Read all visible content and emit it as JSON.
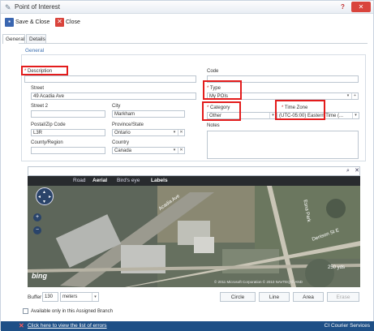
{
  "window": {
    "title": "Point of Interest",
    "help_glyph": "?",
    "close_glyph": "✕"
  },
  "toolbar": {
    "save_close_label": "Save & Close",
    "close_label": "Close"
  },
  "tabs": [
    {
      "label": "General",
      "active": true
    },
    {
      "label": "Details",
      "active": false
    }
  ],
  "section": {
    "title": "General"
  },
  "form": {
    "description": {
      "label": "Description",
      "value": ""
    },
    "code": {
      "label": "Code",
      "value": ""
    },
    "street": {
      "label": "Street",
      "value": "49 Acadia Ave"
    },
    "type": {
      "label": "Type",
      "value": "My POIs"
    },
    "street2": {
      "label": "Street 2",
      "value": ""
    },
    "city": {
      "label": "City",
      "value": "Markham"
    },
    "category": {
      "label": "Category",
      "value": "Other"
    },
    "timezone": {
      "label": "Time Zone",
      "value": "(UTC-05:00) Eastern Time (..."
    },
    "postal": {
      "label": "Postal/Zip Code",
      "value": "L3R"
    },
    "province": {
      "label": "Province/State",
      "value": "Ontario"
    },
    "notes": {
      "label": "Notes",
      "value": ""
    },
    "county": {
      "label": "County/Region",
      "value": ""
    },
    "country": {
      "label": "Country",
      "value": "Canada"
    }
  },
  "search": {
    "value": ""
  },
  "map": {
    "tabs": [
      "Road",
      "Aerial",
      "Bird's eye",
      "Labels"
    ],
    "selected_tab": "Aerial",
    "street_labels": [
      "Acadia Ave",
      "Esna Park",
      "Denison St E"
    ],
    "scale_label": "250 yds",
    "logo": "bing",
    "copyright": "© 2011 Microsoft Corporation © 2010 NAVTEQ © AND"
  },
  "buffer": {
    "label": "Buffer",
    "value": "130",
    "unit": "meters"
  },
  "draw_buttons": [
    "Circle",
    "Line",
    "Area",
    "Erase"
  ],
  "branch_checkbox": {
    "label": "Available only in this Assigned Branch",
    "checked": false
  },
  "status": {
    "error_link": "Click here to view the list of errors",
    "company": "CI Courier Services"
  },
  "colors": {
    "highlight": "#e31c1c",
    "statusbar": "#1e4f86",
    "section_title": "#3b6fb0"
  }
}
